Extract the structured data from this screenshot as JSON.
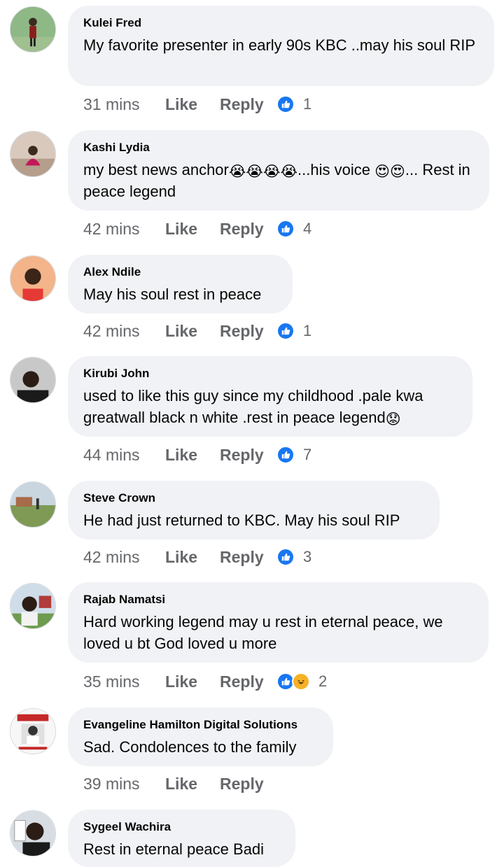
{
  "comments": [
    {
      "name": "Kulei Fred",
      "text": "My favorite presenter in early  90s KBC ..may his soul RIP",
      "time": "31 mins",
      "like": "Like",
      "reply": "Reply",
      "reactions": "1",
      "avatar_bg": "#7aa57a"
    },
    {
      "name": "Kashi Lydia",
      "text_before": "my best news anchor",
      "emoji_a": "😭😭😭😭",
      "text_mid": "...his voice ",
      "emoji_b": "😍😍",
      "text_after": "... Rest in peace legend",
      "time": "42 mins",
      "like": "Like",
      "reply": "Reply",
      "reactions": "4",
      "avatar_bg": "#c9b3a4"
    },
    {
      "name": "Alex Ndile",
      "text": "May his soul rest in peace",
      "time": "42 mins",
      "like": "Like",
      "reply": "Reply",
      "reactions": "1",
      "avatar_bg": "#e8a57b"
    },
    {
      "name": "Kirubi John",
      "text_before": "used to like this guy since my childhood .pale kwa greatwall black n white .rest in peace legend",
      "emoji_a": "😟",
      "time": "44 mins",
      "like": "Like",
      "reply": "Reply",
      "reactions": "7",
      "avatar_bg": "#9a9a9a"
    },
    {
      "name": "Steve Crown",
      "text": "He had just returned to KBC. May his soul RIP",
      "time": "42 mins",
      "like": "Like",
      "reply": "Reply",
      "reactions": "3",
      "avatar_bg": "#8aa06a"
    },
    {
      "name": "Rajab Namatsi",
      "text": "Hard working legend may u rest in eternal peace, we loved u bt God loved u more",
      "time": "35 mins",
      "like": "Like",
      "reply": "Reply",
      "reactions": "2",
      "avatar_bg": "#b7c7d6"
    },
    {
      "name": "Evangeline Hamilton Digital Solutions",
      "text": "Sad. Condolences to the family",
      "time": "39 mins",
      "like": "Like",
      "reply": "Reply",
      "reactions": "",
      "avatar_bg": "#f2f2f2"
    },
    {
      "name": "Sygeel Wachira",
      "text": "Rest in eternal peace Badi",
      "avatar_bg": "#d0d8e0"
    }
  ],
  "colors": {
    "bubble": "#f0f2f5",
    "meta": "#65676b",
    "like_blue": "#1877f2",
    "haha": "#f7b125"
  },
  "icons": {
    "like": "thumbs-up-icon",
    "haha": "haha-icon"
  }
}
